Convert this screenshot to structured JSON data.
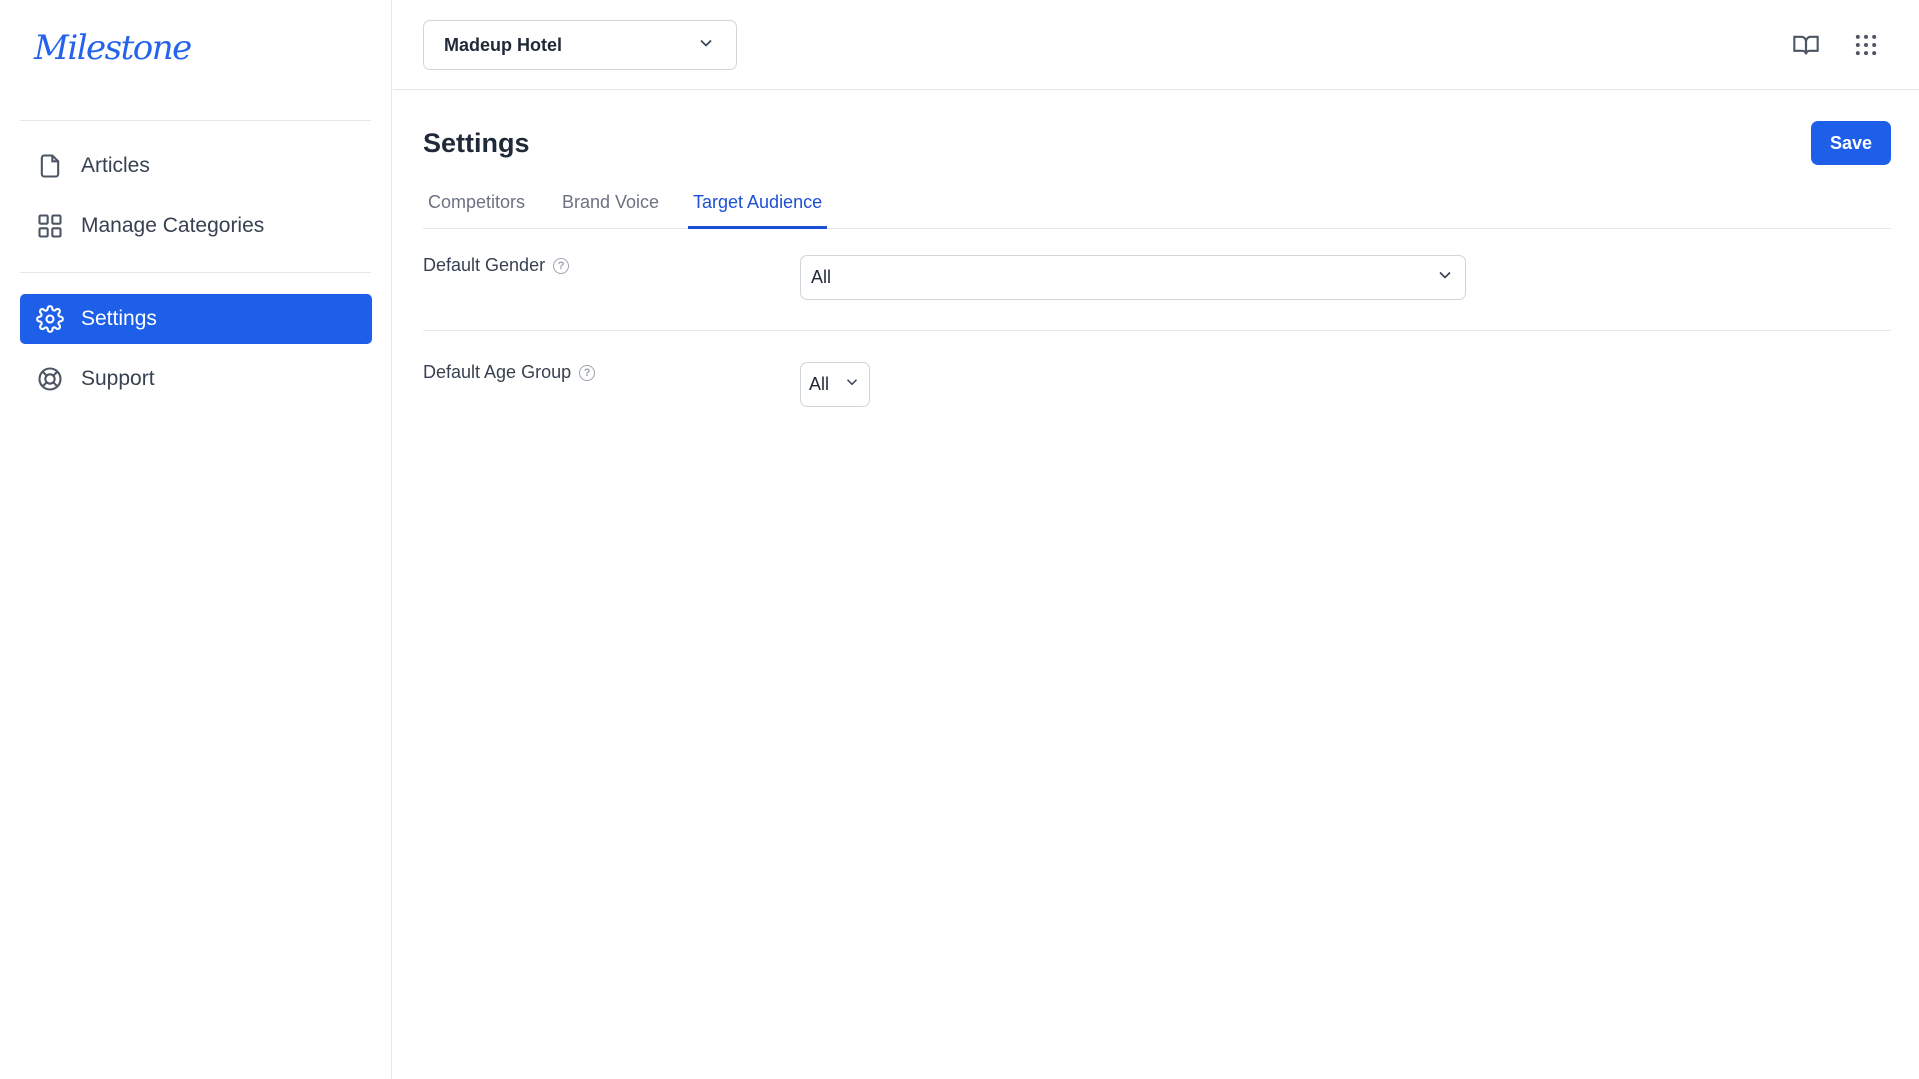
{
  "app": {
    "logo": "Milestone"
  },
  "sidebar": {
    "items": [
      {
        "label": "Articles",
        "icon": "file-icon"
      },
      {
        "label": "Manage Categories",
        "icon": "grid-icon"
      },
      {
        "label": "Settings",
        "icon": "gear-icon"
      },
      {
        "label": "Support",
        "icon": "lifebuoy-icon"
      }
    ],
    "active": "Settings"
  },
  "header": {
    "hotel_select": {
      "value": "Madeup Hotel"
    },
    "icons": [
      "book-icon",
      "apps-grid-icon"
    ]
  },
  "main": {
    "title": "Settings",
    "save_label": "Save",
    "tabs": [
      {
        "label": "Competitors"
      },
      {
        "label": "Brand Voice"
      },
      {
        "label": "Target Audience"
      }
    ],
    "active_tab": "Target Audience",
    "fields": {
      "gender": {
        "label": "Default Gender",
        "value": "All"
      },
      "age_group": {
        "label": "Default Age Group",
        "value": "All"
      }
    }
  },
  "colors": {
    "accent": "#1d5fe8",
    "logo": "#2563eb",
    "border": "#e5e7eb"
  }
}
